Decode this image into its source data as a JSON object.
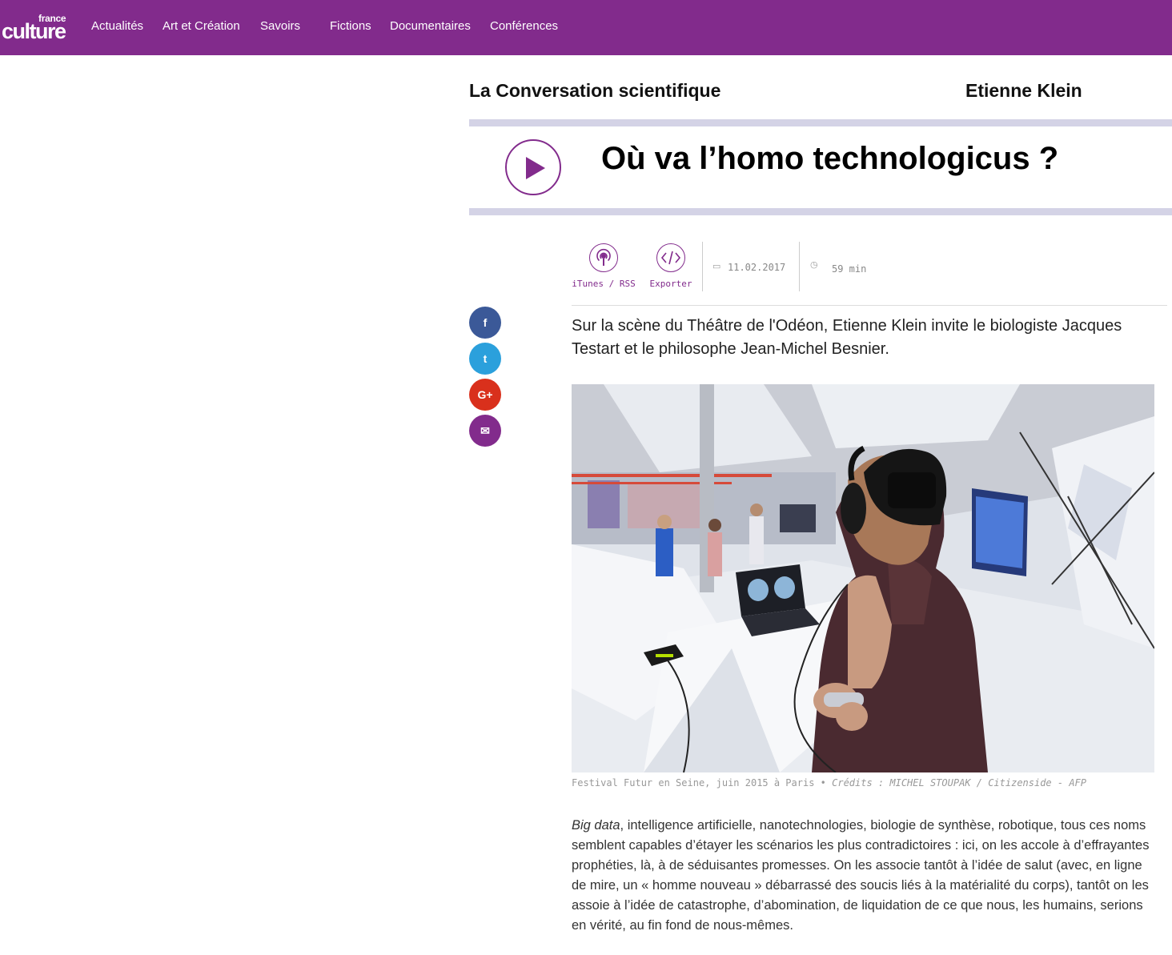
{
  "brand": {
    "logo_small": "france",
    "logo_big": "culture",
    "color": "#822b8c"
  },
  "nav": {
    "items": [
      {
        "label": "Actualités"
      },
      {
        "label": "Art et Création"
      },
      {
        "label": "Savoirs"
      },
      {
        "label": "Fictions"
      },
      {
        "label": "Documentaires"
      },
      {
        "label": "Conférences"
      }
    ]
  },
  "show": {
    "title": "La Conversation scientifique",
    "producer": "Etienne Klein"
  },
  "episode": {
    "title": "Où va l’homo technologicus ?",
    "play_icon": "play-icon",
    "date": "11.02.2017",
    "duration": "59 min"
  },
  "tools": [
    {
      "label": "iTunes / RSS",
      "icon": "podcast-icon"
    },
    {
      "label": "Exporter",
      "icon": "code-icon"
    }
  ],
  "share": [
    {
      "icon": "facebook-icon",
      "glyph": "f",
      "color": "#3b5998"
    },
    {
      "icon": "twitter-icon",
      "glyph": "t",
      "color": "#2ba0dc"
    },
    {
      "icon": "google-plus-icon",
      "glyph": "G+",
      "color": "#d9301c"
    },
    {
      "icon": "email-icon",
      "glyph": "✉",
      "color": "#822b8c"
    }
  ],
  "lead": "Sur la scène du Théâtre de l'Odéon, Etienne Klein invite le biologiste Jacques Testart et le philosophe Jean-Michel Besnier.",
  "image": {
    "caption": "Festival Futur en Seine, juin 2015 à Paris",
    "credit": "Crédits : MICHEL STOUPAK / Citizenside - AFP"
  },
  "body": {
    "lead_italic": "Big data",
    "text": ", intelligence artificielle, nanotechnologies, biologie de synthèse, robotique, tous ces noms semblent capables d’étayer les scénarios les plus contradictoires : ici, on les accole à d’effrayantes prophéties, là, à de séduisantes promesses. On les associe tantôt à l’idée de salut (avec, en ligne de mire, un « homme nouveau » débarrassé des soucis liés à la matérialité du corps), tantôt on les assoie à l’idée de catastrophe, d’abomination, de liquidation de ce que nous, les humains, serions en vérité, au fin fond de nous-mêmes."
  }
}
